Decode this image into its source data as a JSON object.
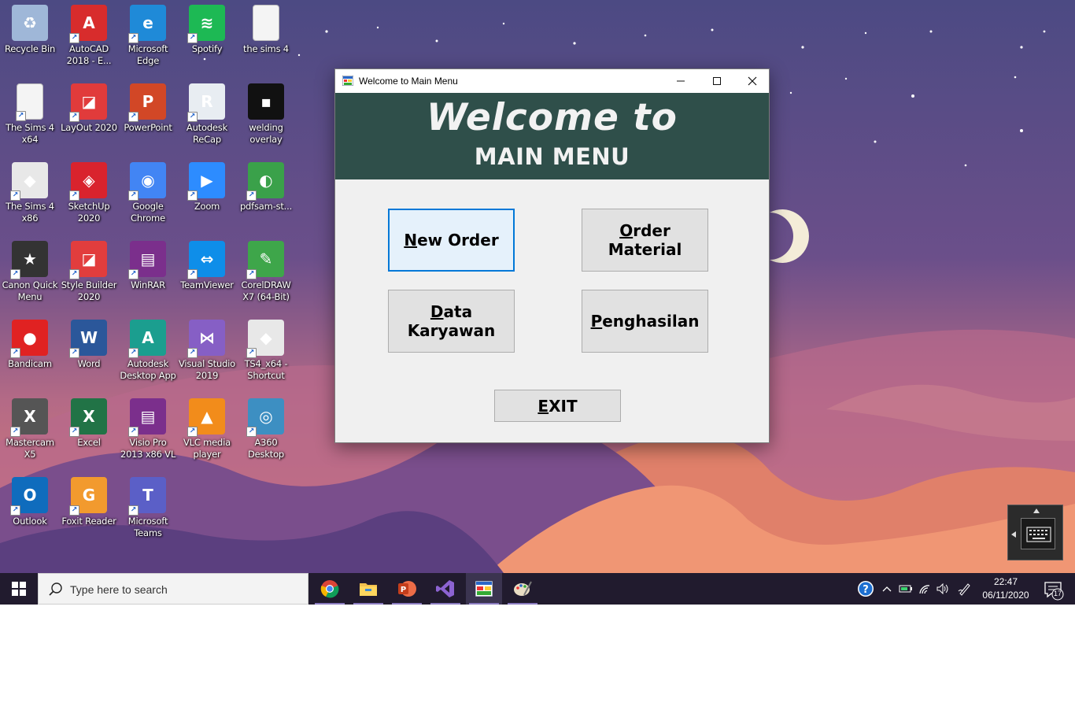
{
  "desktop": {
    "icons": [
      {
        "label": "Recycle Bin",
        "icon": "recycle-bin-icon",
        "color": "#9fb7d8",
        "glyph": "♻",
        "shortcut": false
      },
      {
        "label": "AutoCAD\n2018 - E...",
        "icon": "autocad-icon",
        "color": "#d82c2c",
        "glyph": "A",
        "shortcut": true
      },
      {
        "label": "Microsoft\nEdge",
        "icon": "edge-icon",
        "color": "#1f8ad8",
        "glyph": "e",
        "shortcut": true
      },
      {
        "label": "Spotify",
        "icon": "spotify-icon",
        "color": "#1db954",
        "glyph": "≋",
        "shortcut": true
      },
      {
        "label": "the sims 4",
        "icon": "document-icon",
        "color": "#f4f4f4",
        "glyph": "",
        "shortcut": false
      },
      {
        "label": "The Sims 4\nx64",
        "icon": "document-icon",
        "color": "#f4f4f4",
        "glyph": "",
        "shortcut": true
      },
      {
        "label": "LayOut 2020",
        "icon": "layout-icon",
        "color": "#e13b3b",
        "glyph": "◪",
        "shortcut": true
      },
      {
        "label": "PowerPoint",
        "icon": "powerpoint-icon",
        "color": "#d24726",
        "glyph": "P",
        "shortcut": true
      },
      {
        "label": "Autodesk\nReCap",
        "icon": "recap-icon",
        "color": "#e8edf2",
        "glyph": "R",
        "shortcut": true
      },
      {
        "label": "welding\noverlay",
        "icon": "video-file-icon",
        "color": "#111111",
        "glyph": "▪",
        "shortcut": false
      },
      {
        "label": "The Sims 4\nx86",
        "icon": "sims-icon",
        "color": "#e8e8e8",
        "glyph": "◆",
        "shortcut": true
      },
      {
        "label": "SketchUp\n2020",
        "icon": "sketchup-icon",
        "color": "#d9232d",
        "glyph": "◈",
        "shortcut": true
      },
      {
        "label": "Google\nChrome",
        "icon": "chrome-icon",
        "color": "#4285f4",
        "glyph": "◉",
        "shortcut": true
      },
      {
        "label": "Zoom",
        "icon": "zoom-icon",
        "color": "#2d8cff",
        "glyph": "▶",
        "shortcut": true
      },
      {
        "label": "pdfsam-st...",
        "icon": "pdfsam-icon",
        "color": "#3aa14a",
        "glyph": "◐",
        "shortcut": true
      },
      {
        "label": "Canon Quick\nMenu",
        "icon": "canon-icon",
        "color": "#333333",
        "glyph": "★",
        "shortcut": true
      },
      {
        "label": "Style Builder\n2020",
        "icon": "style-builder-icon",
        "color": "#e23d3d",
        "glyph": "◪",
        "shortcut": true
      },
      {
        "label": "WinRAR",
        "icon": "winrar-icon",
        "color": "#7b2f8c",
        "glyph": "▤",
        "shortcut": true
      },
      {
        "label": "TeamViewer",
        "icon": "teamviewer-icon",
        "color": "#0e8ee9",
        "glyph": "⇔",
        "shortcut": true
      },
      {
        "label": "CorelDRAW\nX7 (64-Bit)",
        "icon": "coreldraw-icon",
        "color": "#3ea64a",
        "glyph": "✎",
        "shortcut": true
      },
      {
        "label": "Bandicam",
        "icon": "bandicam-icon",
        "color": "#e02222",
        "glyph": "●",
        "shortcut": true
      },
      {
        "label": "Word",
        "icon": "word-icon",
        "color": "#2b579a",
        "glyph": "W",
        "shortcut": true
      },
      {
        "label": "Autodesk\nDesktop App",
        "icon": "autodesk-desktop-icon",
        "color": "#1b9e8f",
        "glyph": "A",
        "shortcut": true
      },
      {
        "label": "Visual Studio\n2019",
        "icon": "visual-studio-icon",
        "color": "#865fc5",
        "glyph": "⋈",
        "shortcut": true
      },
      {
        "label": "TS4_x64 -\nShortcut",
        "icon": "sims-icon",
        "color": "#e8e8e8",
        "glyph": "◆",
        "shortcut": true
      },
      {
        "label": "Mastercam\nX5",
        "icon": "mastercam-icon",
        "color": "#555555",
        "glyph": "X",
        "shortcut": true
      },
      {
        "label": "Excel",
        "icon": "excel-icon",
        "color": "#217346",
        "glyph": "X",
        "shortcut": true
      },
      {
        "label": "Visio Pro\n2013 x86 VL",
        "icon": "winrar-icon",
        "color": "#7b2f8c",
        "glyph": "▤",
        "shortcut": true
      },
      {
        "label": "VLC media\nplayer",
        "icon": "vlc-icon",
        "color": "#f28c1b",
        "glyph": "▲",
        "shortcut": true
      },
      {
        "label": "A360\nDesktop",
        "icon": "a360-icon",
        "color": "#3d8fc2",
        "glyph": "◎",
        "shortcut": true
      },
      {
        "label": "Outlook",
        "icon": "outlook-icon",
        "color": "#0f6cbd",
        "glyph": "O",
        "shortcut": true
      },
      {
        "label": "Foxit Reader",
        "icon": "foxit-icon",
        "color": "#f29a2e",
        "glyph": "G",
        "shortcut": true
      },
      {
        "label": "Microsoft\nTeams",
        "icon": "teams-icon",
        "color": "#5b5fc7",
        "glyph": "T",
        "shortcut": true
      }
    ]
  },
  "window": {
    "title": "Welcome to Main Menu",
    "banner_line1": "Welcome to",
    "banner_line2": "MAIN MENU",
    "banner_color": "#2f4f4a",
    "buttons": {
      "new_order": {
        "mnemonic": "N",
        "rest": "ew Order"
      },
      "order_material": {
        "mnemonic": "O",
        "rest_line1": "rder",
        "line2": "Material"
      },
      "data_karyawan": {
        "mnemonic": "D",
        "rest_line1": "ata",
        "line2": "Karyawan"
      },
      "penghasilan": {
        "mnemonic": "P",
        "rest": "enghasilan"
      },
      "exit": {
        "mnemonic": "E",
        "rest": "XIT"
      }
    }
  },
  "taskbar": {
    "search_placeholder": "Type here to search",
    "time": "22:47",
    "date": "06/11/2020",
    "notification_count": "17",
    "pinned": [
      "chrome-icon",
      "file-explorer-icon",
      "powerpoint-icon",
      "visual-studio-icon",
      "winforms-app-icon",
      "paint-icon"
    ]
  }
}
